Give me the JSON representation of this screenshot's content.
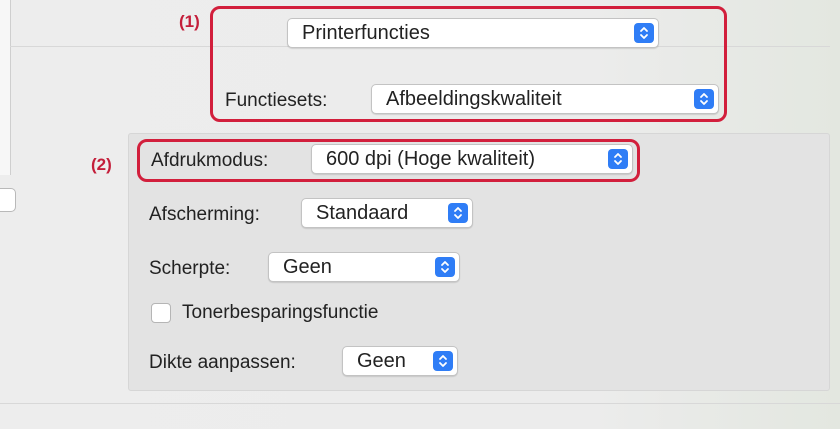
{
  "callouts": {
    "one": "(1)",
    "two": "(2)"
  },
  "printer_menu": {
    "value": "Printerfuncties"
  },
  "feature_sets": {
    "label": "Functiesets:",
    "value": "Afbeeldingskwaliteit"
  },
  "print_mode": {
    "label": "Afdrukmodus:",
    "value": "600 dpi (Hoge kwaliteit)"
  },
  "screening": {
    "label": "Afscherming:",
    "value": "Standaard"
  },
  "sharpness": {
    "label": "Scherpte:",
    "value": "Geen"
  },
  "toner_save": {
    "label": "Tonerbesparingsfunctie",
    "checked": false
  },
  "thickness": {
    "label": "Dikte aanpassen:",
    "value": "Geen"
  },
  "colors": {
    "accent": "#2f7df6",
    "highlight": "#d21f3c"
  },
  "icons": {
    "stepper": "up-down-chevron-icon"
  }
}
